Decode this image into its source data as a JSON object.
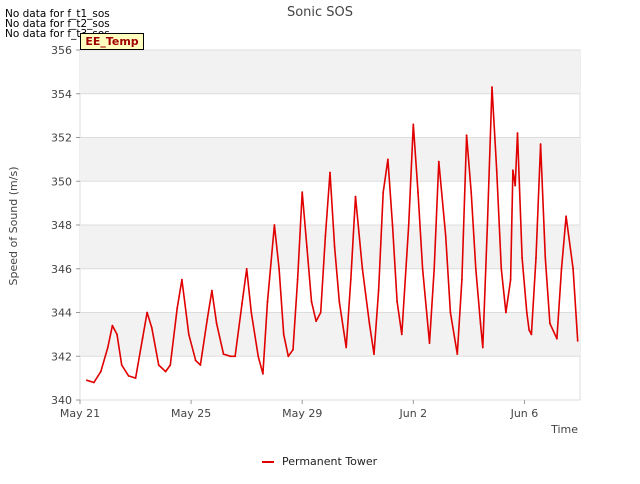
{
  "notices": [
    "No data for f_t1_sos",
    "No data for f_t2_sos",
    "No data for f_t3_sos"
  ],
  "tag_label": "EE_Temp",
  "colors": {
    "series": "#e00000",
    "band": "#f2f2f2",
    "grid": "#dddddd",
    "tag_bg": "#ffffc0",
    "tag_text": "#a00000"
  },
  "chart_data": {
    "type": "line",
    "title": "Sonic SOS",
    "xlabel": "Time",
    "ylabel": "Speed of Sound (m/s)",
    "ylim": [
      340,
      356
    ],
    "xlim": [
      "2021-05-21",
      "2021-06-08"
    ],
    "grid": true,
    "legend_position": "bottom-center",
    "x_ticks": [
      "May 21",
      "May 25",
      "May 29",
      "Jun 2",
      "Jun 6"
    ],
    "x_tick_dates": [
      "2021-05-21",
      "2021-05-25",
      "2021-05-29",
      "2021-06-02",
      "2021-06-06"
    ],
    "y_ticks": [
      340,
      342,
      344,
      346,
      348,
      350,
      352,
      354,
      356
    ],
    "series": [
      {
        "name": "Permanent Tower",
        "color": "#e00000",
        "points": [
          [
            "2021-05-21 06:00",
            340.9
          ],
          [
            "2021-05-21 12:00",
            340.8
          ],
          [
            "2021-05-21 18:00",
            341.3
          ],
          [
            "2021-05-22 00:00",
            342.4
          ],
          [
            "2021-05-22 04:00",
            343.4
          ],
          [
            "2021-05-22 08:00",
            343.0
          ],
          [
            "2021-05-22 12:00",
            341.6
          ],
          [
            "2021-05-22 18:00",
            341.1
          ],
          [
            "2021-05-23 00:00",
            341.0
          ],
          [
            "2021-05-23 06:00",
            342.8
          ],
          [
            "2021-05-23 10:00",
            344.0
          ],
          [
            "2021-05-23 14:00",
            343.3
          ],
          [
            "2021-05-23 20:00",
            341.6
          ],
          [
            "2021-05-24 02:00",
            341.3
          ],
          [
            "2021-05-24 06:00",
            341.6
          ],
          [
            "2021-05-24 12:00",
            344.2
          ],
          [
            "2021-05-24 16:00",
            345.5
          ],
          [
            "2021-05-24 22:00",
            343.0
          ],
          [
            "2021-05-25 04:00",
            341.8
          ],
          [
            "2021-05-25 08:00",
            341.6
          ],
          [
            "2021-05-25 14:00",
            343.7
          ],
          [
            "2021-05-25 18:00",
            345.0
          ],
          [
            "2021-05-25 22:00",
            343.5
          ],
          [
            "2021-05-26 04:00",
            342.1
          ],
          [
            "2021-05-26 10:00",
            342.0
          ],
          [
            "2021-05-26 14:00",
            342.0
          ],
          [
            "2021-05-26 20:00",
            344.4
          ],
          [
            "2021-05-27 00:00",
            346.0
          ],
          [
            "2021-05-27 04:00",
            344.0
          ],
          [
            "2021-05-27 10:00",
            342.0
          ],
          [
            "2021-05-27 14:00",
            341.2
          ],
          [
            "2021-05-27 18:00",
            344.5
          ],
          [
            "2021-05-28 00:00",
            348.0
          ],
          [
            "2021-05-28 04:00",
            346.0
          ],
          [
            "2021-05-28 08:00",
            343.0
          ],
          [
            "2021-05-28 12:00",
            342.0
          ],
          [
            "2021-05-28 16:00",
            342.3
          ],
          [
            "2021-05-28 20:00",
            345.5
          ],
          [
            "2021-05-29 00:00",
            349.5
          ],
          [
            "2021-05-29 04:00",
            347.0
          ],
          [
            "2021-05-29 08:00",
            344.5
          ],
          [
            "2021-05-29 12:00",
            343.6
          ],
          [
            "2021-05-29 16:00",
            344.0
          ],
          [
            "2021-05-29 20:00",
            347.5
          ],
          [
            "2021-05-30 00:00",
            350.4
          ],
          [
            "2021-05-30 04:00",
            347.0
          ],
          [
            "2021-05-30 08:00",
            344.5
          ],
          [
            "2021-05-30 14:00",
            342.4
          ],
          [
            "2021-05-30 18:00",
            345.5
          ],
          [
            "2021-05-30 22:00",
            349.3
          ],
          [
            "2021-05-31 04:00",
            346.0
          ],
          [
            "2021-05-31 10:00",
            343.5
          ],
          [
            "2021-05-31 14:00",
            342.1
          ],
          [
            "2021-05-31 18:00",
            345.0
          ],
          [
            "2021-05-31 22:00",
            349.5
          ],
          [
            "2021-06-01 02:00",
            351.0
          ],
          [
            "2021-06-01 06:00",
            348.0
          ],
          [
            "2021-06-01 10:00",
            344.5
          ],
          [
            "2021-06-01 14:00",
            343.0
          ],
          [
            "2021-06-01 20:00",
            348.0
          ],
          [
            "2021-06-02 00:00",
            352.6
          ],
          [
            "2021-06-02 04:00",
            349.5
          ],
          [
            "2021-06-02 08:00",
            346.0
          ],
          [
            "2021-06-02 14:00",
            342.6
          ],
          [
            "2021-06-02 18:00",
            346.0
          ],
          [
            "2021-06-02 22:00",
            350.9
          ],
          [
            "2021-06-03 04:00",
            347.5
          ],
          [
            "2021-06-03 08:00",
            344.0
          ],
          [
            "2021-06-03 14:00",
            342.1
          ],
          [
            "2021-06-03 18:00",
            345.5
          ],
          [
            "2021-06-03 22:00",
            352.1
          ],
          [
            "2021-06-04 02:00",
            349.5
          ],
          [
            "2021-06-04 06:00",
            346.0
          ],
          [
            "2021-06-04 10:00",
            343.5
          ],
          [
            "2021-06-04 12:00",
            342.4
          ],
          [
            "2021-06-04 16:00",
            348.0
          ],
          [
            "2021-06-04 20:00",
            354.3
          ],
          [
            "2021-06-05 00:00",
            350.5
          ],
          [
            "2021-06-05 04:00",
            346.0
          ],
          [
            "2021-06-05 08:00",
            344.0
          ],
          [
            "2021-06-05 12:00",
            345.5
          ],
          [
            "2021-06-05 14:00",
            350.5
          ],
          [
            "2021-06-05 16:00",
            349.8
          ],
          [
            "2021-06-05 18:00",
            352.2
          ],
          [
            "2021-06-05 22:00",
            346.5
          ],
          [
            "2021-06-06 02:00",
            344.0
          ],
          [
            "2021-06-06 04:00",
            343.2
          ],
          [
            "2021-06-06 06:00",
            343.0
          ],
          [
            "2021-06-06 10:00",
            346.5
          ],
          [
            "2021-06-06 14:00",
            351.7
          ],
          [
            "2021-06-06 18:00",
            346.5
          ],
          [
            "2021-06-06 22:00",
            343.5
          ],
          [
            "2021-06-07 04:00",
            342.8
          ],
          [
            "2021-06-07 08:00",
            346.0
          ],
          [
            "2021-06-07 12:00",
            348.4
          ],
          [
            "2021-06-07 18:00",
            346.0
          ],
          [
            "2021-06-07 22:00",
            342.7
          ]
        ]
      }
    ]
  }
}
